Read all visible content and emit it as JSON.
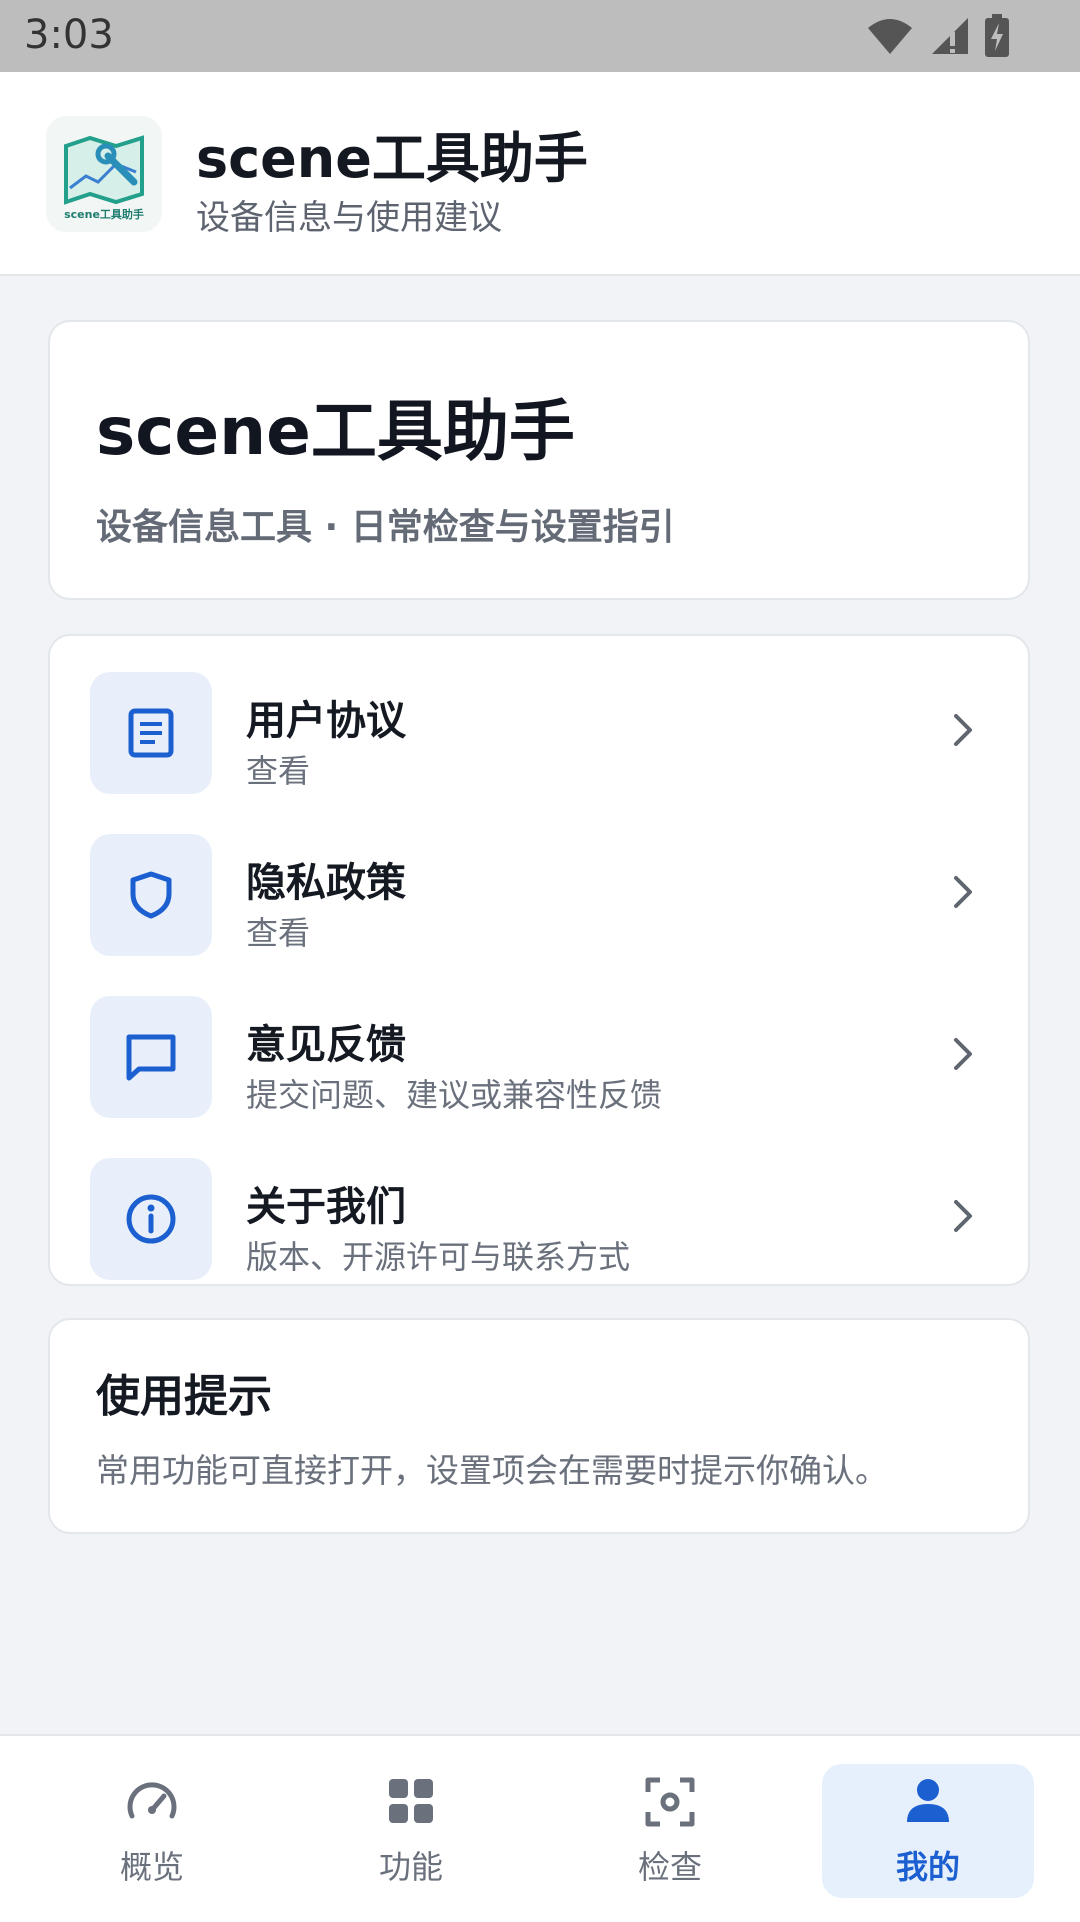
{
  "status_bar": {
    "time": "3:03"
  },
  "app_bar": {
    "logo_text": "scene工具助手",
    "title": "scene工具助手",
    "subtitle": "设备信息与使用建议"
  },
  "hero": {
    "title": "scene工具助手",
    "subtitle": "设备信息工具 · 日常检查与设置指引"
  },
  "menu": {
    "items": [
      {
        "icon": "document-icon",
        "title": "用户协议",
        "subtitle": "查看"
      },
      {
        "icon": "shield-icon",
        "title": "隐私政策",
        "subtitle": "查看"
      },
      {
        "icon": "chat-icon",
        "title": "意见反馈",
        "subtitle": "提交问题、建议或兼容性反馈"
      },
      {
        "icon": "info-icon",
        "title": "关于我们",
        "subtitle": "版本、开源许可与联系方式"
      }
    ]
  },
  "tip": {
    "title": "使用提示",
    "text": "常用功能可直接打开，设置项会在需要时提示你确认。"
  },
  "bottom_nav": {
    "items": [
      {
        "icon": "gauge-icon",
        "label": "概览"
      },
      {
        "icon": "grid-icon",
        "label": "功能"
      },
      {
        "icon": "scan-icon",
        "label": "检查"
      },
      {
        "icon": "person-icon",
        "label": "我的",
        "active": true
      }
    ]
  },
  "colors": {
    "accent": "#1c5fd0",
    "icon_bg": "#e8effa",
    "page_bg": "#f1f3f6"
  }
}
